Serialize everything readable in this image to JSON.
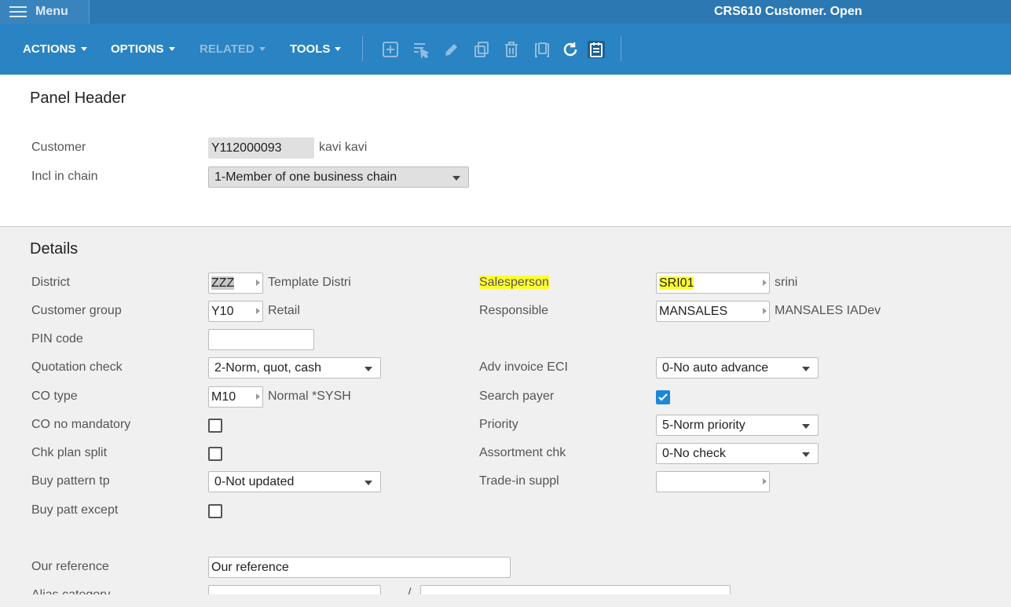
{
  "topbar": {
    "menu_label": "Menu",
    "app_title": "CRS610 Customer. Open"
  },
  "toolbar": {
    "actions": "ACTIONS",
    "options": "OPTIONS",
    "related": "RELATED",
    "tools": "TOOLS",
    "icons": [
      "add-icon",
      "select-icon",
      "edit-icon",
      "copy-icon",
      "delete-icon",
      "display-icon",
      "refresh-icon",
      "notes-icon"
    ]
  },
  "panel_header": {
    "title": "Panel Header",
    "customer_label": "Customer",
    "customer_value": "Y112000093",
    "customer_name": "kavi kavi",
    "chain_label": "Incl in chain",
    "chain_value": "1-Member of one business chain"
  },
  "details": {
    "title": "Details",
    "district_label": "District",
    "district_value": "ZZZ",
    "district_desc": "Template Distri",
    "custgroup_label": "Customer group",
    "custgroup_value": "Y10",
    "custgroup_desc": "Retail",
    "pin_label": "PIN code",
    "pin_value": "",
    "quot_label": "Quotation check",
    "quot_value": "2-Norm, quot, cash",
    "cotype_label": "CO type",
    "cotype_value": "M10",
    "cotype_desc": "Normal *SYSH",
    "cono_label": "CO no mandatory",
    "cono_checked": false,
    "plansplit_label": "Chk plan split",
    "plansplit_checked": false,
    "buypat_label": "Buy pattern tp",
    "buypat_value": "0-Not updated",
    "buyexc_label": "Buy patt except",
    "buyexc_checked": false,
    "ourref_label": "Our reference",
    "ourref_value": "Our reference",
    "alias_label": "Alias category",
    "alias_sep": "/",
    "salesperson_label": "Salesperson",
    "salesperson_value": "SRI01",
    "salesperson_desc": "srini",
    "responsible_label": "Responsible",
    "responsible_value": "MANSALES",
    "responsible_desc": "MANSALES IADev",
    "advinv_label": "Adv invoice ECI",
    "advinv_value": "0-No auto advance",
    "searchpayer_label": "Search payer",
    "searchpayer_checked": true,
    "priority_label": "Priority",
    "priority_value": "5-Norm priority",
    "assort_label": "Assortment chk",
    "assort_value": "0-No check",
    "tradein_label": "Trade-in suppl",
    "tradein_value": ""
  },
  "colors": {
    "topbar": "#2b78b3",
    "toolbar": "#2a83c2",
    "highlight": "#ffff30",
    "checkbox": "#1e88d6"
  }
}
